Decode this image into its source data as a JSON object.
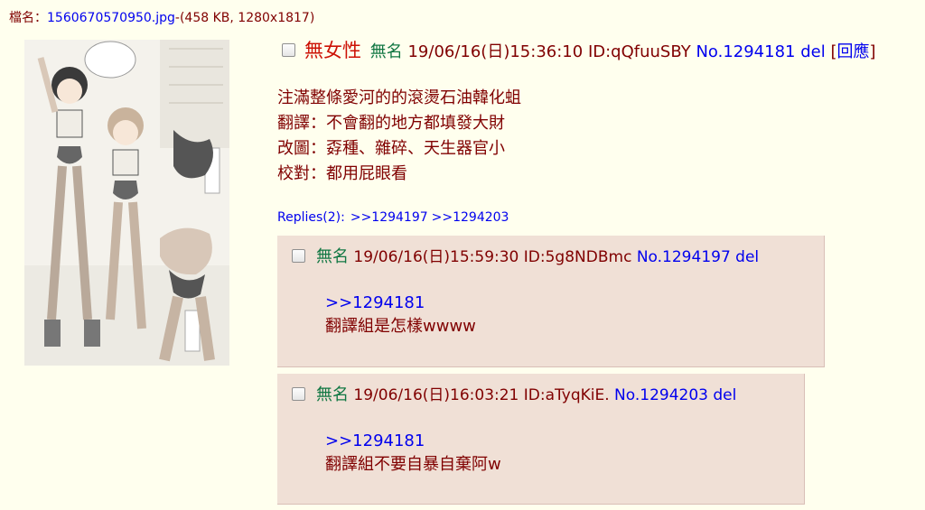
{
  "file": {
    "label": "檔名：",
    "filename": "1560670570950.jpg",
    "meta": "-(458 KB, 1280x1817)"
  },
  "op": {
    "subject": "無女性",
    "name": "無名",
    "datetime": "19/06/16(日)15:36:10",
    "id": "ID:qQfuuSBY",
    "postno": "No.1294181",
    "del": "del",
    "reply_bracket_open": "[",
    "reply_label": "回應",
    "reply_bracket_close": "]",
    "body": [
      "注滿整條愛河的的滾燙石油韓化蛆",
      "翻譯：不會翻的地方都填發大財",
      "改圖：孬種、雜碎、天生器官小",
      "校對：都用屁眼看"
    ],
    "replies_label": "Replies(2):",
    "replies": [
      ">>1294197",
      ">>1294203"
    ]
  },
  "posts": [
    {
      "name": "無名",
      "datetime": "19/06/16(日)15:59:30",
      "id": "ID:5g8NDBmc",
      "postno": "No.1294197",
      "del": "del",
      "quote": ">>1294181",
      "text": "翻譯組是怎樣wwww"
    },
    {
      "name": "無名",
      "datetime": "19/06/16(日)16:03:21",
      "id": "ID:aTyqKiE.",
      "postno": "No.1294203",
      "del": "del",
      "quote": ">>1294181",
      "text": "翻譯組不要自暴自棄阿w"
    }
  ],
  "colors": {
    "background": "#FFFFEE",
    "text": "#800000",
    "subject": "#CC1105",
    "name": "#117743",
    "link": "#0000EE",
    "reply_bg": "#F0E0D6"
  }
}
